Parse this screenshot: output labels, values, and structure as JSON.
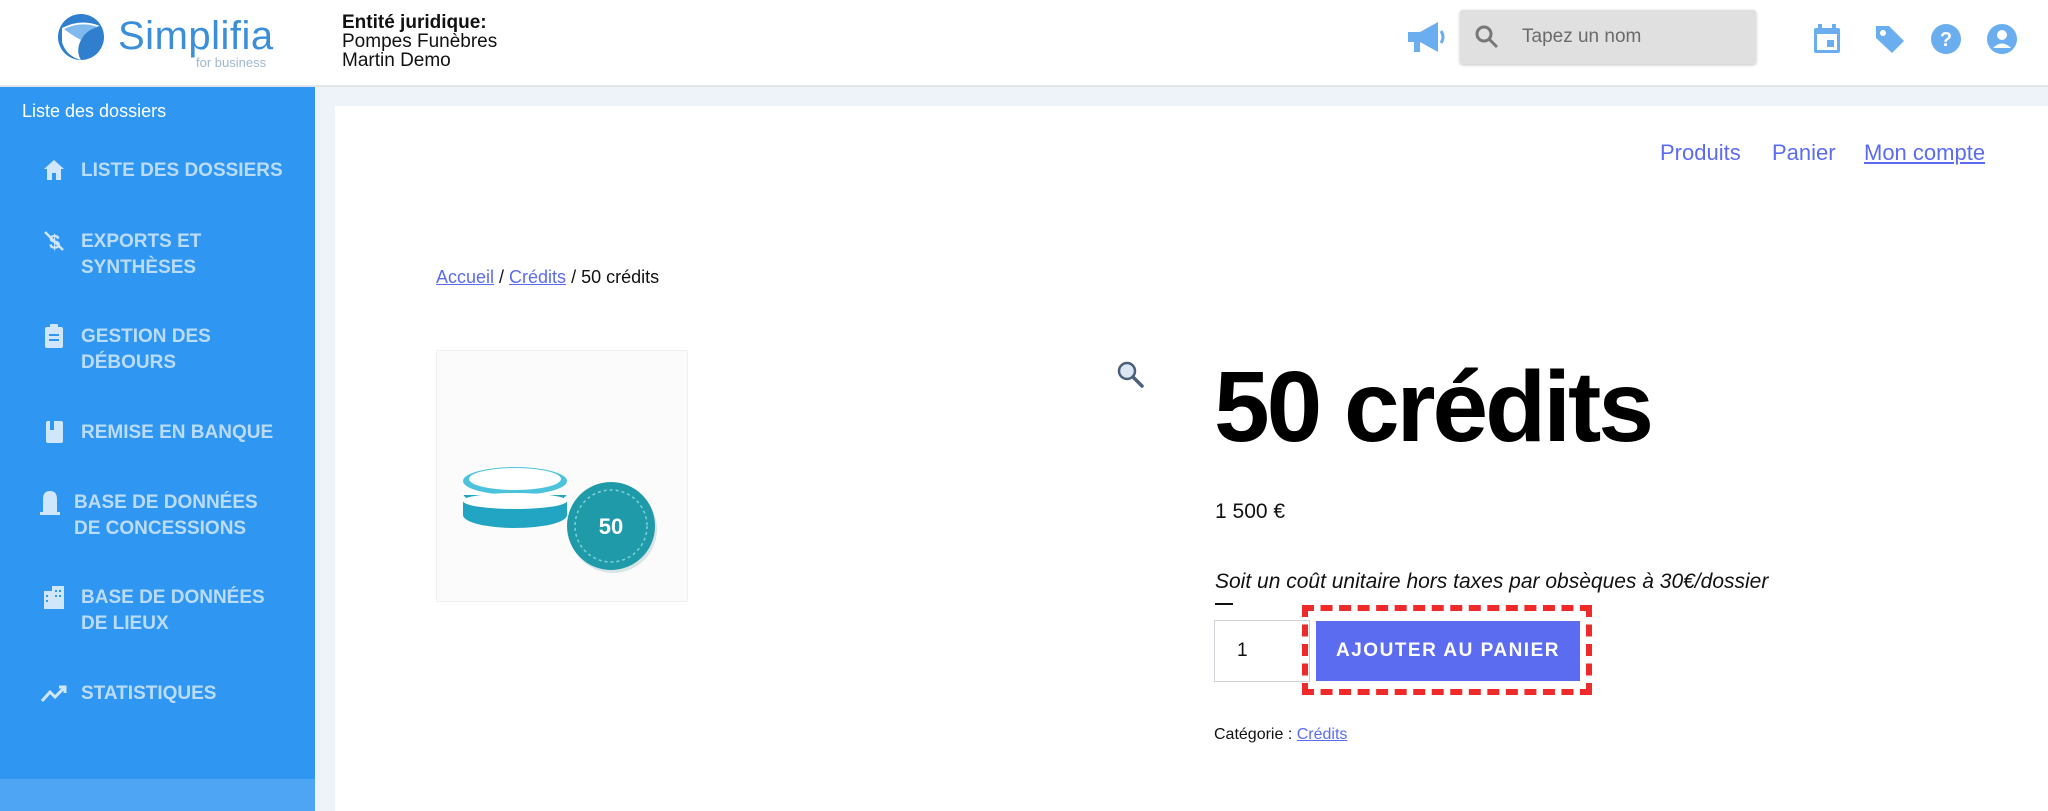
{
  "header": {
    "logo_text": "Simplifia",
    "logo_sub": "for business",
    "entity_label": "Entité juridique:",
    "entity_line1": "Pompes Funèbres",
    "entity_line2": "Martin Demo",
    "search_placeholder": "Tapez un nom"
  },
  "sidebar": {
    "title": "Liste des dossiers",
    "items": [
      {
        "label": "LISTE DES DOSSIERS",
        "icon": "home-icon"
      },
      {
        "label": "EXPORTS ET SYNTHÈSES",
        "icon": "money-off-icon"
      },
      {
        "label": "GESTION DES DÉBOURS",
        "icon": "clipboard-icon"
      },
      {
        "label": "REMISE EN BANQUE",
        "icon": "book-icon"
      },
      {
        "label": "BASE DE DONNÉES DE CONCESSIONS",
        "icon": "tombstone-icon"
      },
      {
        "label": "BASE DE DONNÉES DE LIEUX",
        "icon": "building-icon"
      },
      {
        "label": "STATISTIQUES",
        "icon": "trending-icon"
      }
    ]
  },
  "topnav": {
    "products": "Produits",
    "cart": "Panier",
    "account": "Mon compte"
  },
  "breadcrumb": {
    "home": "Accueil",
    "sep1": " / ",
    "credits": "Crédits",
    "sep2": " / ",
    "current": "50 crédits"
  },
  "product": {
    "badge": "50",
    "title": "50 crédits",
    "price": "1 500 €",
    "description": "Soit un coût unitaire hors taxes par obsèques à 30€/dossier",
    "quantity": "1",
    "add_button": "AJOUTER AU PANIER",
    "category_label": "Catégorie : ",
    "category_link": "Crédits"
  },
  "colors": {
    "sidebar": "#2f96f1",
    "accent": "#5b6cf0",
    "highlight": "#ef2a2a"
  }
}
